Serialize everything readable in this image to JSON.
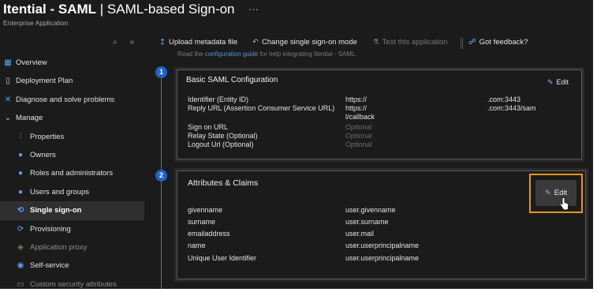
{
  "header": {
    "title_bold": "Itential - SAML",
    "title_rest": " | SAML-based Sign-on",
    "ellipsis": "···",
    "subtitle": "Enterprise Application"
  },
  "sidebar": {
    "tools": [
      "⌕",
      "«"
    ],
    "items": [
      {
        "label": "Overview",
        "icon": "grid-icon"
      },
      {
        "label": "Deployment Plan",
        "icon": "book-icon"
      },
      {
        "label": "Diagnose and solve problems",
        "icon": "wrench-icon"
      },
      {
        "label": "Manage",
        "icon": "chevron-down-icon"
      },
      {
        "label": "Properties",
        "icon": "properties-icon"
      },
      {
        "label": "Owners",
        "icon": "people-icon"
      },
      {
        "label": "Roles and administrators",
        "icon": "roles-icon"
      },
      {
        "label": "Users and groups",
        "icon": "users-icon"
      },
      {
        "label": "Single sign-on",
        "icon": "sso-icon"
      },
      {
        "label": "Provisioning",
        "icon": "provisioning-icon"
      },
      {
        "label": "Application proxy",
        "icon": "proxy-icon"
      },
      {
        "label": "Self-service",
        "icon": "self-service-icon"
      },
      {
        "label": "Custom security attributes",
        "icon": "tag-icon"
      }
    ]
  },
  "toolbar": {
    "upload": "Upload metadata file",
    "change": "Change single sign-on mode",
    "test": "Test this application",
    "feedback": "Got feedback?"
  },
  "main": {
    "cut_prefix": "Read the",
    "cut_link": "configuration guide",
    "cut_suffix": "for help integrating Itential - SAML.",
    "step1": "1",
    "step2": "2",
    "basic": {
      "title": "Basic SAML Configuration",
      "edit": "Edit",
      "rows": [
        {
          "label": "Identifier (Entity ID)",
          "value": "https://",
          "value2": ".com:3443"
        },
        {
          "label": "Reply URL (Assertion Consumer Service URL)",
          "value": "https://",
          "value2": ".com:3443/sam"
        },
        {
          "label": "",
          "value": "l/callback",
          "value2": ""
        },
        {
          "label": "Sign on URL",
          "value": "Optional",
          "value2": ""
        },
        {
          "label": "Relay State (Optional)",
          "value": "Optional",
          "value2": ""
        },
        {
          "label": "Logout Url (Optional)",
          "value": "Optional",
          "value2": ""
        }
      ]
    },
    "claims": {
      "title": "Attributes & Claims",
      "edit": "Edit",
      "rows": [
        {
          "label": "givenname",
          "value": "user.givenname"
        },
        {
          "label": "surname",
          "value": "user.surname"
        },
        {
          "label": "emailaddress",
          "value": "user.mail"
        },
        {
          "label": "name",
          "value": "user.userprincipalname"
        },
        {
          "label": "Unique User Identifier",
          "value": "user.userprincipalname"
        }
      ]
    }
  },
  "colors": {
    "background": "#1b1b1b",
    "accent": "#1f63c8",
    "highlight": "#e8951c"
  }
}
